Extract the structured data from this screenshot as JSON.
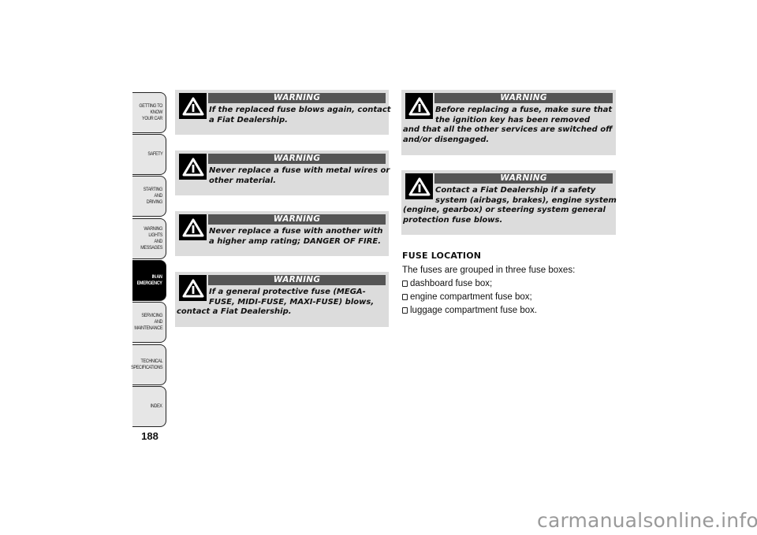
{
  "sidebar": {
    "tabs": [
      {
        "label": "GETTING TO KNOW\nYOUR CAR",
        "active": false
      },
      {
        "label": "SAFETY",
        "active": false
      },
      {
        "label": "STARTING AND\nDRIVING",
        "active": false
      },
      {
        "label": "WARNING LIGHTS\nAND MESSAGES",
        "active": false
      },
      {
        "label": "IN AN\nEMERGENCY",
        "active": true
      },
      {
        "label": "SERVICING AND\nMAINTENANCE",
        "active": false
      },
      {
        "label": "TECHNICAL\nSPECIFICATIONS",
        "active": false
      },
      {
        "label": "INDEX",
        "active": false
      }
    ],
    "page_number": "188"
  },
  "warnings_left": [
    {
      "heading": "WARNING",
      "icon": "warning-triangle-icon",
      "lines": [
        "If the replaced fuse blows again, contact",
        "a Fiat Dealership."
      ]
    },
    {
      "heading": "WARNING",
      "icon": "warning-triangle-icon",
      "lines": [
        "Never replace a fuse with metal wires or",
        "other material."
      ]
    },
    {
      "heading": "WARNING",
      "icon": "warning-triangle-icon",
      "lines": [
        "Never replace a fuse with another with",
        "a higher amp rating; DANGER OF FIRE."
      ]
    },
    {
      "heading": "WARNING",
      "icon": "warning-triangle-icon",
      "lines": [
        "If a general protective fuse (MEGA-",
        "FUSE, MIDI-FUSE, MAXI-FUSE) blows,",
        "contact a Fiat Dealership."
      ]
    }
  ],
  "warnings_right": [
    {
      "heading": "WARNING",
      "icon": "warning-triangle-icon",
      "lines": [
        "Before replacing a fuse, make sure that",
        "the ignition key has been removed",
        "and that all the other services are switched off",
        "and/or disengaged."
      ]
    },
    {
      "heading": "WARNING",
      "icon": "warning-triangle-icon",
      "lines": [
        "Contact a Fiat Dealership if a safety",
        "system (airbags, brakes), engine system",
        "(engine, gearbox) or steering system general",
        "protection fuse blows."
      ]
    }
  ],
  "fuse_location": {
    "title": "FUSE LOCATION",
    "intro": "The fuses are grouped in three fuse boxes:",
    "items": [
      "dashboard fuse box;",
      "engine compartment fuse box;",
      "luggage compartment fuse box."
    ]
  },
  "watermark": "carmanualsonline.info"
}
